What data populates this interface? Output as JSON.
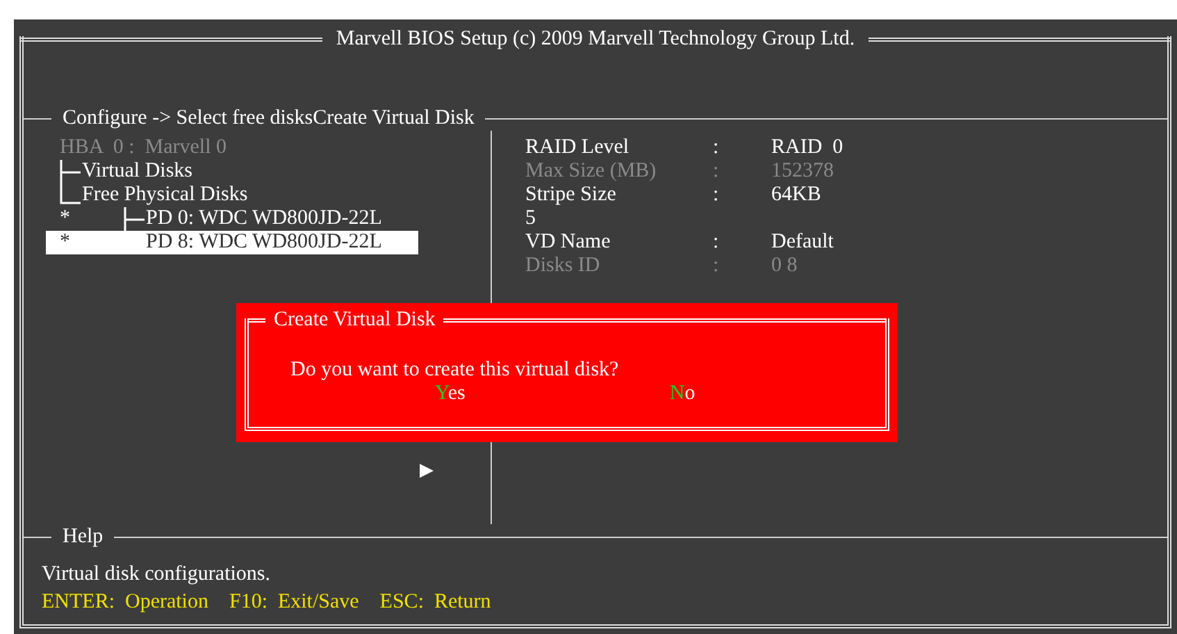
{
  "window": {
    "title": "Marvell BIOS Setup (c) 2009 Marvell Technology Group Ltd."
  },
  "section": {
    "title": "Configure -> Select free disksCreate Virtual Disk"
  },
  "tree": {
    "label": "HBA  0 :  Marvell 0",
    "disabled": true,
    "children": [
      {
        "label": "Virtual Disks"
      },
      {
        "label": "Free Physical Disks",
        "children": [
          {
            "label": "PD 0: WDC WD800JD-22L",
            "marker": "*",
            "selected": false
          },
          {
            "label": "PD 8: WDC WD800JD-22L",
            "marker": "*",
            "selected": true
          }
        ]
      }
    ]
  },
  "pointer": "▶",
  "settings": [
    {
      "kind": "field",
      "label": "RAID Level",
      "separator": ":",
      "value": "RAID  0",
      "disabled": false
    },
    {
      "kind": "field",
      "label": "Max Size (MB)",
      "separator": ":",
      "value": "152378",
      "disabled": true
    },
    {
      "kind": "field",
      "label": "Stripe Size",
      "separator": ":",
      "value": "64KB",
      "disabled": false
    },
    {
      "kind": "text",
      "label": "5"
    },
    {
      "kind": "field",
      "label": "VD Name",
      "separator": ":",
      "value": "Default",
      "disabled": false
    },
    {
      "kind": "field",
      "label": "Disks ID",
      "separator": ":",
      "value": "0 8",
      "disabled": true
    }
  ],
  "dialog": {
    "title": "Create Virtual Disk",
    "message": "Do you want to create this virtual disk?",
    "buttons": [
      {
        "hotkey": "Y",
        "rest": "es"
      },
      {
        "hotkey": "N",
        "rest": "o"
      }
    ]
  },
  "help": {
    "title": "Help",
    "text": "Virtual disk configurations.",
    "keys": "ENTER:  Operation    F10:  Exit/Save    ESC:  Return"
  }
}
